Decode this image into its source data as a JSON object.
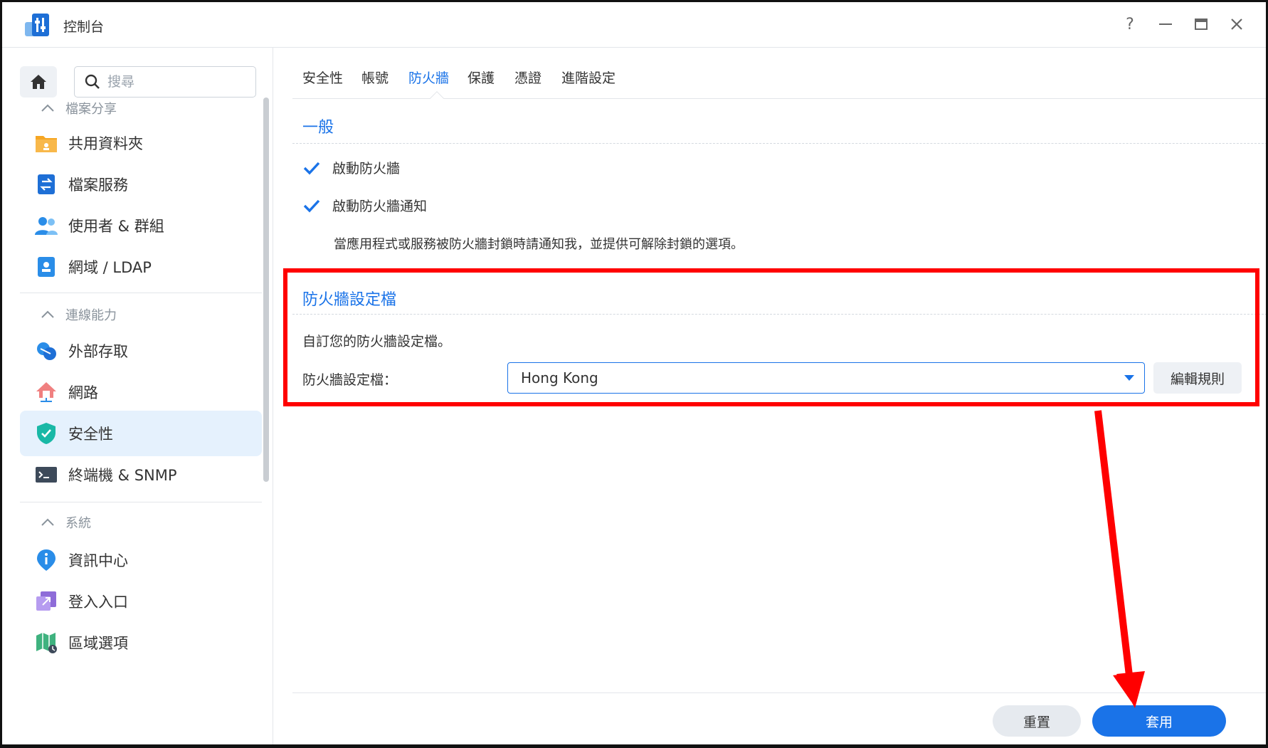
{
  "window": {
    "title": "控制台",
    "controls": {
      "help": "?",
      "minimize": "—",
      "maximize": "▭",
      "close": "✕"
    }
  },
  "sidebar": {
    "search_placeholder": "搜尋",
    "sections": [
      {
        "header": "檔案分享",
        "items": [
          {
            "label": "共用資料夾",
            "icon": "folder-icon"
          },
          {
            "label": "檔案服務",
            "icon": "file-services-icon"
          },
          {
            "label": "使用者 & 群組",
            "icon": "users-icon"
          },
          {
            "label": "網域 / LDAP",
            "icon": "domain-icon"
          }
        ]
      },
      {
        "header": "連線能力",
        "items": [
          {
            "label": "外部存取",
            "icon": "external-access-icon"
          },
          {
            "label": "網路",
            "icon": "network-icon"
          },
          {
            "label": "安全性",
            "icon": "security-shield-icon",
            "active": true
          },
          {
            "label": "終端機 & SNMP",
            "icon": "terminal-icon"
          }
        ]
      },
      {
        "header": "系統",
        "items": [
          {
            "label": "資訊中心",
            "icon": "info-icon"
          },
          {
            "label": "登入入口",
            "icon": "login-portal-icon"
          },
          {
            "label": "區域選項",
            "icon": "regional-options-icon"
          }
        ]
      }
    ]
  },
  "tabs": [
    {
      "label": "安全性"
    },
    {
      "label": "帳號"
    },
    {
      "label": "防火牆",
      "active": true
    },
    {
      "label": "保護"
    },
    {
      "label": "憑證"
    },
    {
      "label": "進階設定"
    }
  ],
  "general": {
    "title": "一般",
    "enable_firewall": {
      "label": "啟動防火牆",
      "checked": true
    },
    "enable_notification": {
      "label": "啟動防火牆通知",
      "checked": true
    },
    "notification_desc": "當應用程式或服務被防火牆封鎖時請通知我，並提供可解除封鎖的選項。"
  },
  "profile": {
    "title": "防火牆設定檔",
    "desc": "自訂您的防火牆設定檔。",
    "field_label": "防火牆設定檔：",
    "selected": "Hong Kong",
    "edit_button": "編輯規則"
  },
  "footer": {
    "reset_button": "重置",
    "apply_button": "套用"
  },
  "colors": {
    "accent": "#1a73e8",
    "annotation": "#ff0000",
    "active_bg": "#e5f1fd"
  }
}
